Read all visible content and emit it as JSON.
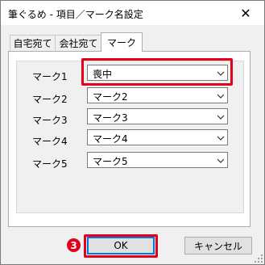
{
  "window": {
    "title": "筆ぐるめ - 項目／マーク名設定",
    "close_glyph": "✕"
  },
  "tabs": [
    {
      "label": "自宅宛て",
      "active": false
    },
    {
      "label": "会社宛て",
      "active": false
    },
    {
      "label": "マーク",
      "active": true
    }
  ],
  "marks": [
    {
      "label": "マーク1",
      "value": "喪中"
    },
    {
      "label": "マーク2",
      "value": "マーク2"
    },
    {
      "label": "マーク3",
      "value": "マーク3"
    },
    {
      "label": "マーク4",
      "value": "マーク4"
    },
    {
      "label": "マーク5",
      "value": "マーク5"
    }
  ],
  "buttons": {
    "ok": "OK",
    "cancel": "キャンセル"
  },
  "annotation": {
    "step_number": "3"
  },
  "colors": {
    "highlight": "#e3001b",
    "accent": "#0078d7"
  }
}
